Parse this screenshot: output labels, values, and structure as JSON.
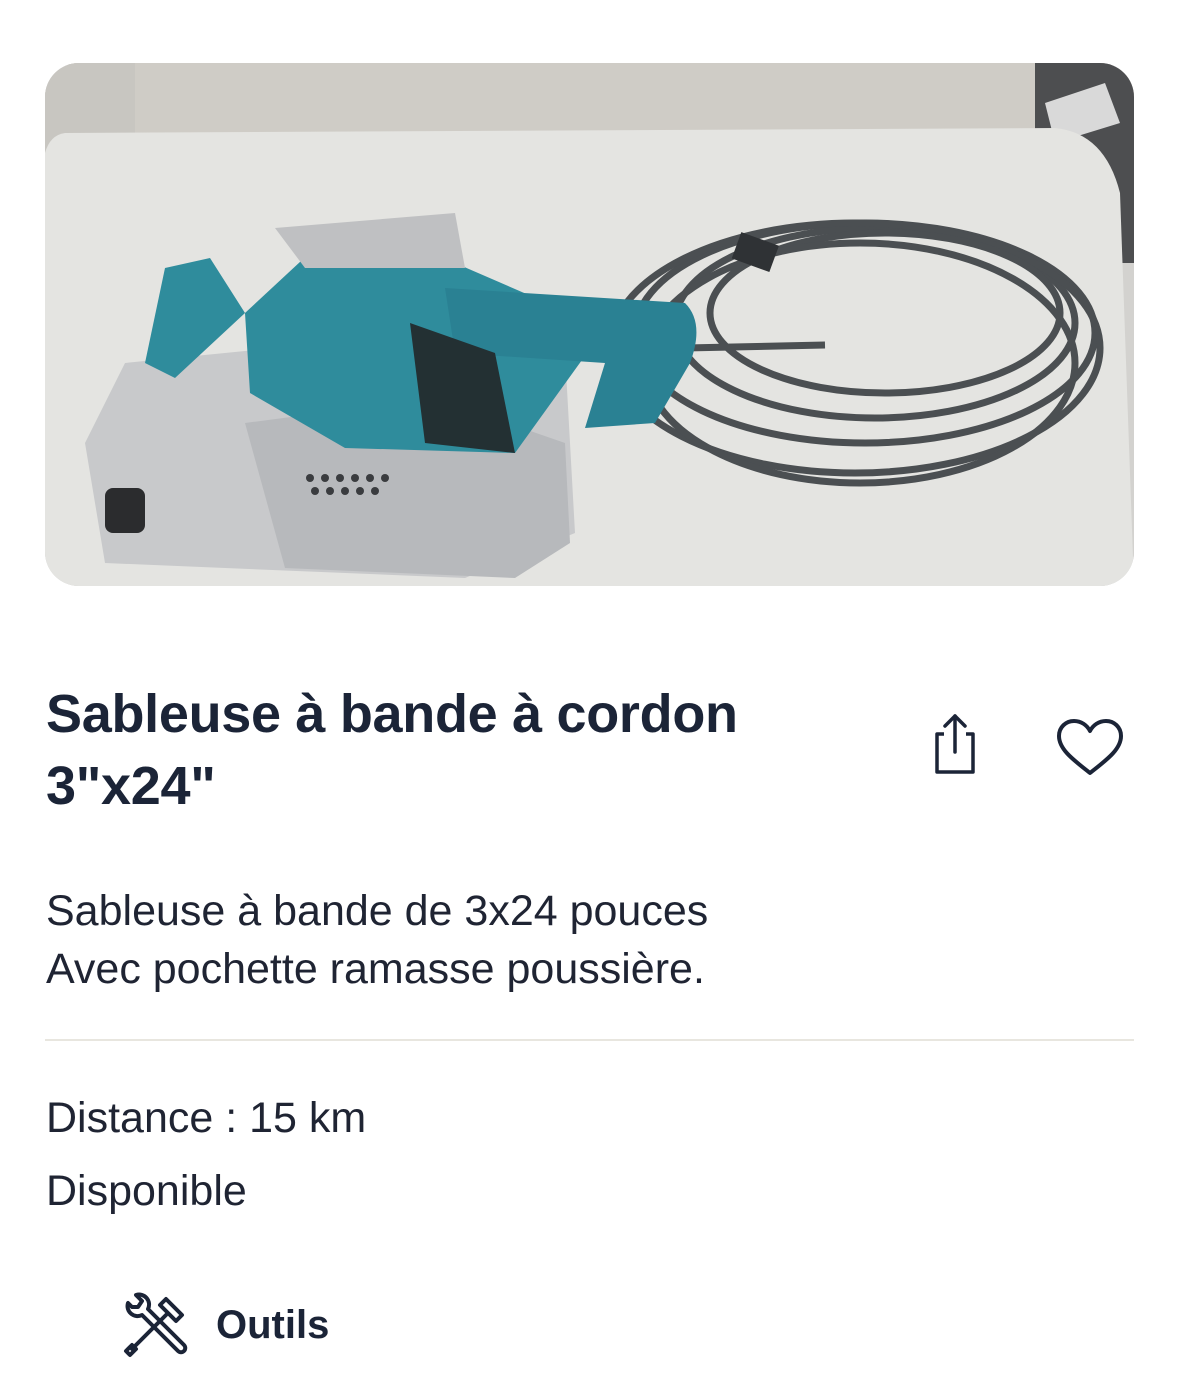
{
  "listing": {
    "title_line1": "Sableuse à bande à cordon",
    "title_line2": "3\"x24\"",
    "description_line1": "Sableuse à bande de 3x24 pouces",
    "description_line2": "Avec pochette ramasse poussière.",
    "distance": "Distance : 15 km",
    "availability": "Disponible"
  },
  "actions": {
    "share_icon": "share-icon",
    "favorite_icon": "heart-icon"
  },
  "category": {
    "icon": "tools-icon",
    "label": "Outils"
  },
  "colors": {
    "text_primary": "#1b2437",
    "divider": "#e8e6df",
    "tool_teal": "#2f8c9c"
  }
}
